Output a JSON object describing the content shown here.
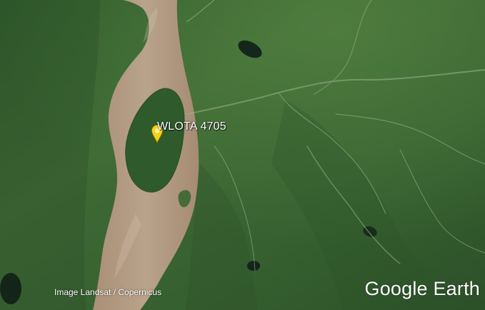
{
  "placemark": {
    "label": "WLOTA 4705",
    "icon": "map-pin-icon",
    "pin_color": "#f4d21b"
  },
  "attribution": {
    "imagery": "Image Landsat / Copernicus"
  },
  "branding": {
    "logo_text": "Google Earth"
  },
  "colors": {
    "river": "#b49f86",
    "land": "#3f6a35",
    "label": "#ffffff"
  }
}
